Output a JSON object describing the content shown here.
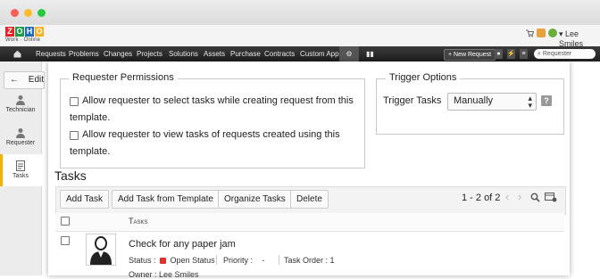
{
  "header": {
    "logo_letters": [
      "Z",
      "O",
      "H",
      "O"
    ],
    "logo_colors": [
      "#e42527",
      "#1b9c47",
      "#226db4",
      "#f9b21d"
    ],
    "logo_subtitle": "Work · Online",
    "user_name": "Lee Smiles"
  },
  "nav": {
    "items": [
      "Requests",
      "Problems",
      "Changes",
      "Projects",
      "Solutions",
      "Assets",
      "Purchase",
      "Contracts",
      "Custom Apps"
    ],
    "new_request_label": "+ New Request",
    "search_placeholder": "Requester"
  },
  "sidebar": {
    "edit_label": "Edit",
    "items": [
      "Technician",
      "Requester",
      "Tasks"
    ]
  },
  "requester_permissions": {
    "legend": "Requester Permissions",
    "options": [
      {
        "line1": "Allow requester to select tasks while creating request from this",
        "line2": "template."
      },
      {
        "line1": "Allow requester to view tasks of requests created using this",
        "line2": "template."
      }
    ]
  },
  "trigger_options": {
    "legend": "Trigger Options",
    "label": "Trigger Tasks",
    "value": "Manually",
    "help": "?"
  },
  "tasks": {
    "heading": "Tasks",
    "buttons": [
      "Add Task",
      "Add Task from Template",
      "Organize Tasks",
      "Delete"
    ],
    "pagination": "1 - 2 of 2",
    "column_header": "Tasks",
    "row": {
      "title": "Check for any paper jam",
      "status_label": "Status :",
      "status_value": "Open Status",
      "status_color": "#e03030",
      "priority_label": "Priority :",
      "priority_value": "-",
      "order_label": "Task Order :",
      "order_value": "1",
      "owner_label": "Owner :",
      "owner_value": "Lee Smiles"
    }
  }
}
